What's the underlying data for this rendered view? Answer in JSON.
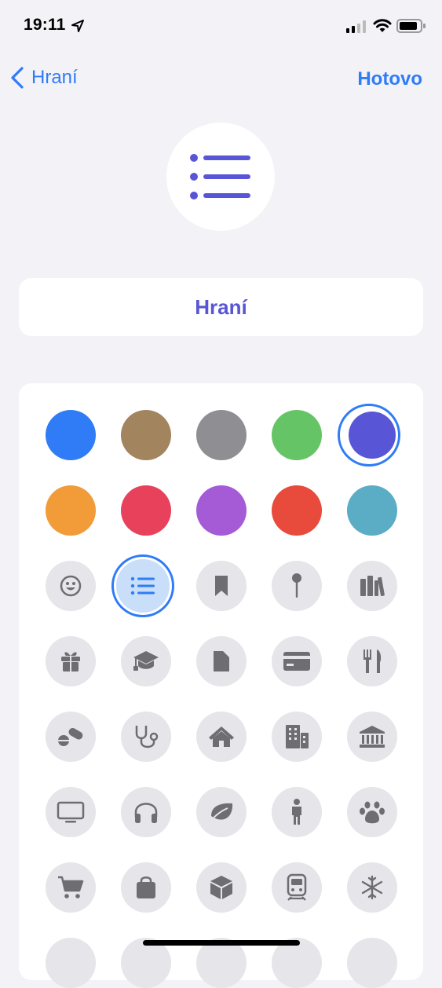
{
  "status_bar": {
    "time": "19:11"
  },
  "nav": {
    "back_label": "Hraní",
    "done_label": "Hotovo"
  },
  "list": {
    "name": "Hraní",
    "icon": "list-bullet-icon",
    "color": "#5856d6"
  },
  "colors": [
    {
      "name": "blue",
      "hex": "#2f7cf6"
    },
    {
      "name": "brown",
      "hex": "#a2845e"
    },
    {
      "name": "gray",
      "hex": "#8e8e93"
    },
    {
      "name": "green",
      "hex": "#65c466"
    },
    {
      "name": "indigo",
      "hex": "#5856d6",
      "selected": true
    },
    {
      "name": "orange",
      "hex": "#f19c38"
    },
    {
      "name": "pink",
      "hex": "#e8415b"
    },
    {
      "name": "purple",
      "hex": "#a55bd6"
    },
    {
      "name": "red",
      "hex": "#e84b3c"
    },
    {
      "name": "teal",
      "hex": "#5aadc4"
    }
  ],
  "icons": [
    "smiley-icon",
    "list-bullet-icon",
    "bookmark-icon",
    "pin-icon",
    "books-icon",
    "gift-icon",
    "graduation-cap-icon",
    "document-icon",
    "credit-card-icon",
    "fork-knife-icon",
    "pills-icon",
    "stethoscope-icon",
    "house-icon",
    "building-icon",
    "bank-icon",
    "tv-icon",
    "headphones-icon",
    "leaf-icon",
    "person-icon",
    "paw-icon",
    "cart-icon",
    "bag-icon",
    "shippingbox-icon",
    "train-icon",
    "snowflake-icon"
  ],
  "selected_icon": "list-bullet-icon"
}
